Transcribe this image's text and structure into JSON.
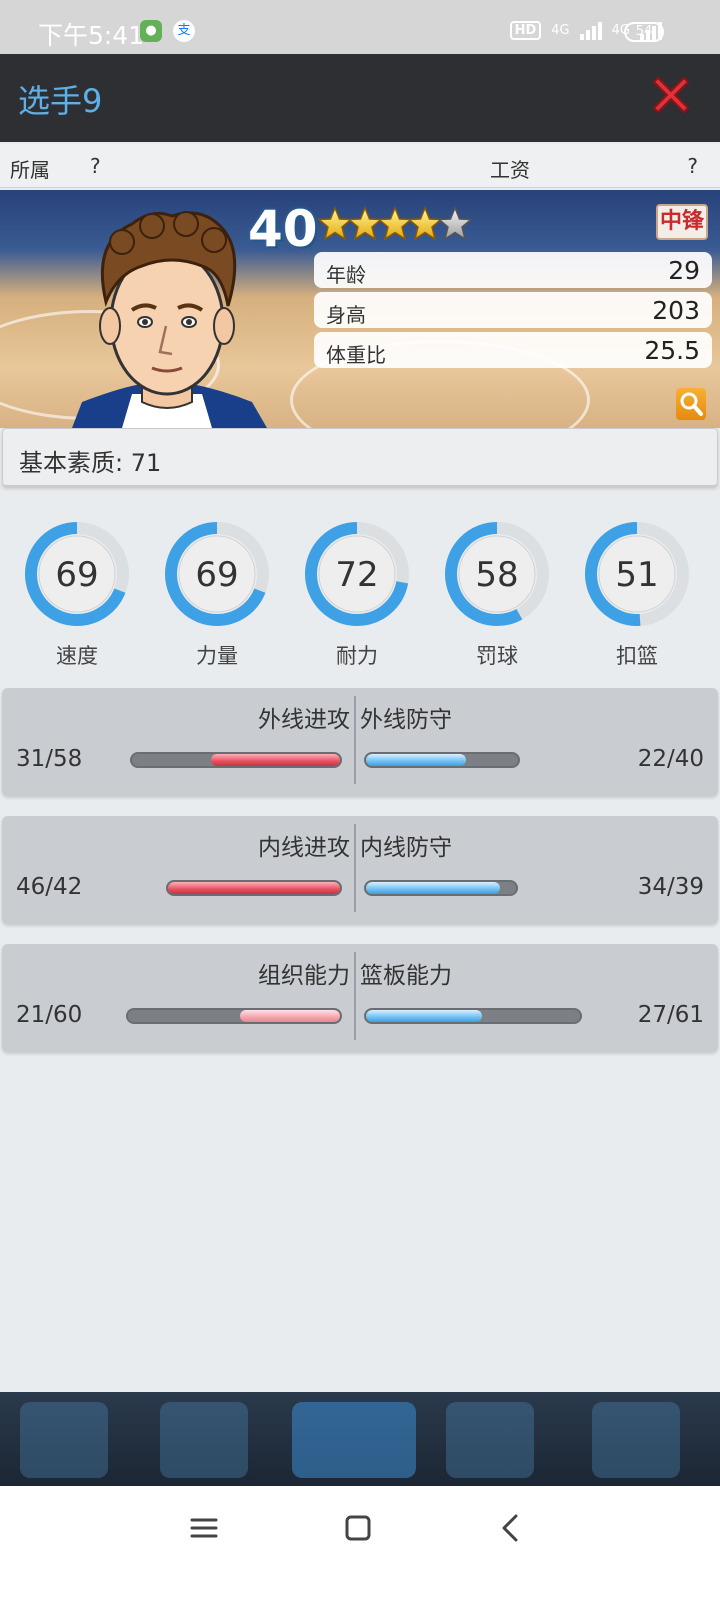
{
  "status_bar": {
    "time": "下午5:41",
    "wechat_icon": "wechat-icon",
    "alipay_label": "支",
    "hd_label": "HD",
    "network_1": "4G",
    "network_2": "4G",
    "battery": "54"
  },
  "dialog": {
    "title": "选手9",
    "close_icon": "close-icon"
  },
  "info_row": {
    "team_label": "所属",
    "team_value": "?",
    "salary_label": "工资",
    "salary_value": "?"
  },
  "player": {
    "rating": "40",
    "stars": 4.5,
    "position": "中锋",
    "attributes": [
      {
        "label": "年龄",
        "value": "29"
      },
      {
        "label": "身高",
        "value": "203"
      },
      {
        "label": "体重比",
        "value": "25.5"
      }
    ]
  },
  "base_quality": {
    "text": "基本素质: 71"
  },
  "rings": [
    {
      "label": "速度",
      "value": "69",
      "fraction": 0.69
    },
    {
      "label": "力量",
      "value": "69",
      "fraction": 0.69
    },
    {
      "label": "耐力",
      "value": "72",
      "fraction": 0.72
    },
    {
      "label": "罚球",
      "value": "58",
      "fraction": 0.58
    },
    {
      "label": "扣篮",
      "value": "51",
      "fraction": 0.51
    }
  ],
  "compare": [
    {
      "left_label": "外线进攻",
      "left_value": "31/58",
      "right_label": "外线防守",
      "right_value": "22/40"
    },
    {
      "left_label": "内线进攻",
      "left_value": "46/42",
      "right_label": "内线防守",
      "right_value": "34/39"
    },
    {
      "left_label": "组织能力",
      "left_value": "21/60",
      "right_label": "篮板能力",
      "right_value": "27/61"
    }
  ],
  "colors": {
    "title": "#5fb0e6",
    "ring_blue": "#3ea1e6",
    "position_red": "#c72b2b"
  }
}
